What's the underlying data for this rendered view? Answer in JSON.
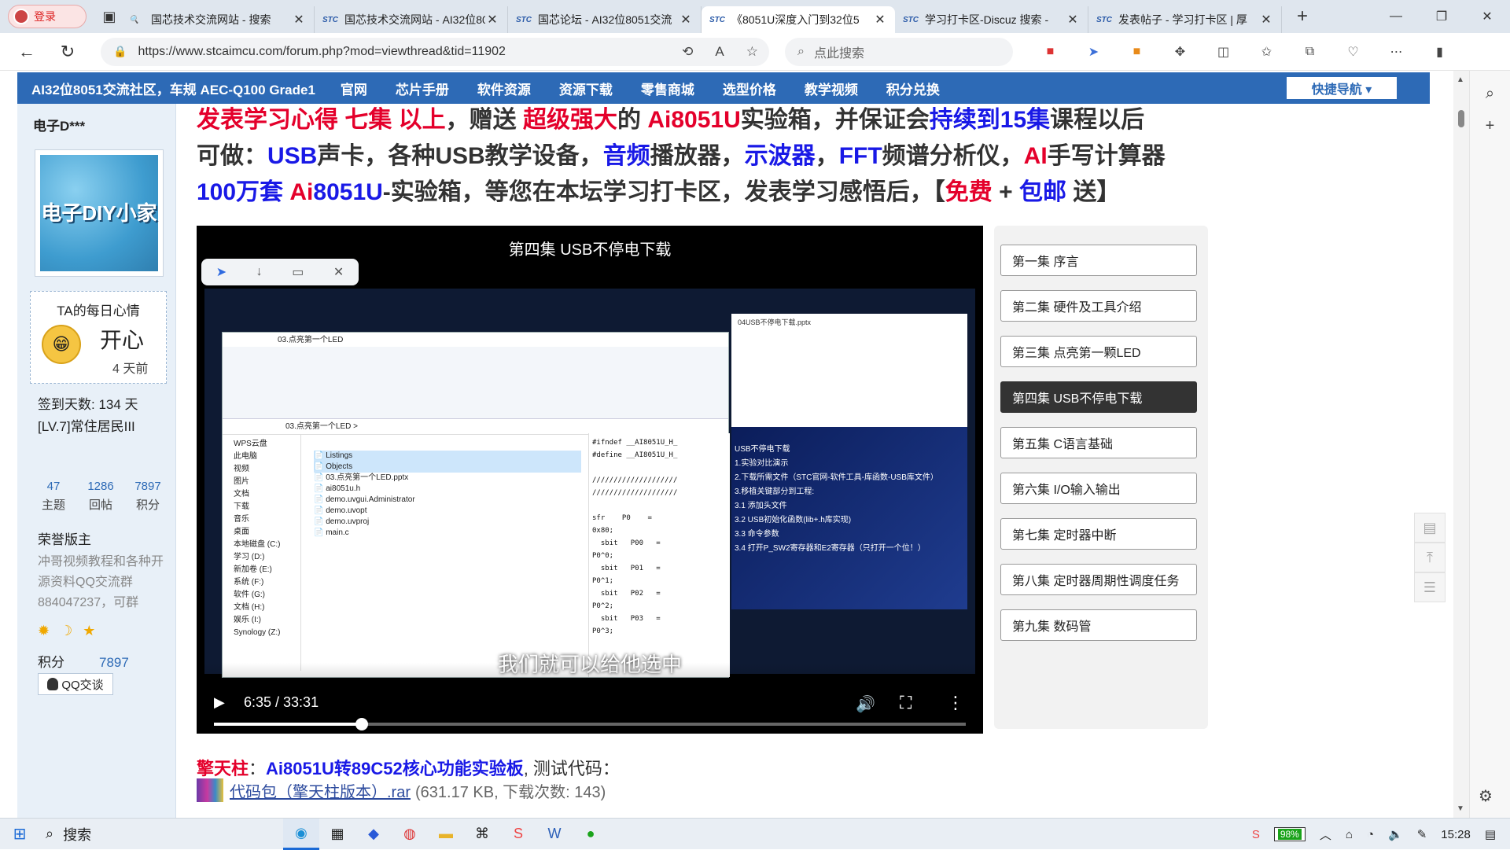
{
  "browser": {
    "profile_label": "登录",
    "tabs": [
      {
        "title": "国芯技术交流网站 - 搜索",
        "active": false,
        "fav": "🔍"
      },
      {
        "title": "国芯技术交流网站 - AI32位8051",
        "active": false,
        "fav": "STC"
      },
      {
        "title": "国芯论坛 - AI32位8051交流",
        "active": false,
        "fav": "STC"
      },
      {
        "title": "《8051U深度入门到32位5",
        "active": true,
        "fav": "STC"
      },
      {
        "title": "学习打卡区-Discuz 搜索 -",
        "active": false,
        "fav": "STC"
      },
      {
        "title": "发表帖子 - 学习打卡区 | 厚",
        "active": false,
        "fav": "STC"
      }
    ],
    "url": "https://www.stcaimcu.com/forum.php?mod=viewthread&tid=11902",
    "search_placeholder": "点此搜索"
  },
  "forum_nav": {
    "title": "AI32位8051交流社区，车规 AEC-Q100 Grade1",
    "items": [
      "官网",
      "芯片手册",
      "软件资源",
      "资源下载",
      "零售商城",
      "选型价格",
      "教学视频",
      "积分兑换"
    ],
    "quick_nav": "快捷导航 ▾"
  },
  "user": {
    "name": "电子D***",
    "avatar_text": "电子DIY小家",
    "mood_title": "TA的每日心情",
    "mood": "开心",
    "mood_time": "4 天前",
    "signin": "签到天数: 134 天",
    "level": "[LV.7]常住居民III",
    "stats": [
      {
        "n": "47",
        "l": "主题"
      },
      {
        "n": "1286",
        "l": "回帖"
      },
      {
        "n": "7897",
        "l": "积分"
      }
    ],
    "honor": "荣誉版主",
    "signature": "冲哥视频教程和各种开源资料QQ交流群884047237，可群",
    "medals": "✹ ☽ ★",
    "score_label": "积分",
    "score_value": "7897",
    "qq_label": "QQ交谈"
  },
  "post": {
    "line1": [
      {
        "t": "发表学习心得 七集 以上",
        "c": "red"
      },
      {
        "t": "，赠送 ",
        "c": ""
      },
      {
        "t": "超级强大",
        "c": "red"
      },
      {
        "t": "的 ",
        "c": ""
      },
      {
        "t": "Ai8051U",
        "c": "red"
      },
      {
        "t": "实验箱，并保证会",
        "c": ""
      },
      {
        "t": "持续到15集",
        "c": "blue"
      },
      {
        "t": "课程以后",
        "c": ""
      }
    ],
    "line2": [
      {
        "t": "可做：",
        "c": ""
      },
      {
        "t": "USB",
        "c": "blue"
      },
      {
        "t": "声卡，各种USB教学设备，",
        "c": ""
      },
      {
        "t": "音频",
        "c": "blue"
      },
      {
        "t": "播放器，",
        "c": ""
      },
      {
        "t": "示波器",
        "c": "blue"
      },
      {
        "t": "，",
        "c": ""
      },
      {
        "t": "FFT",
        "c": "blue"
      },
      {
        "t": "频谱分析仪，",
        "c": ""
      },
      {
        "t": "AI",
        "c": "red"
      },
      {
        "t": "手写计算器",
        "c": ""
      }
    ],
    "line3": [
      {
        "t": "100万套 ",
        "c": "blue"
      },
      {
        "t": "Ai",
        "c": "red"
      },
      {
        "t": "8051U",
        "c": "blue"
      },
      {
        "t": "-实验箱，等您在本坛学习打卡区，发表学习感悟后，【",
        "c": ""
      },
      {
        "t": "免费",
        "c": "red"
      },
      {
        "t": " + ",
        "c": ""
      },
      {
        "t": "包邮",
        "c": "blue"
      },
      {
        "t": " 送】",
        "c": ""
      }
    ]
  },
  "video": {
    "title": "第四集 USB不停电下载",
    "subtitle": "我们就可以给他选中",
    "time": "6:35 / 33:31",
    "progress": 0.197,
    "explorer_title": "03.点亮第一个LED",
    "explorer_path": "03.点亮第一个LED  >",
    "files": [
      "Listings",
      "Objects",
      "03.点亮第一个LED.pptx",
      "ai8051u.h",
      "demo.uvgui.Administrator",
      "demo.uvopt",
      "demo.uvproj",
      "main.c"
    ],
    "nav_items": [
      "WPS云盘",
      "此电脑",
      "视频",
      "图片",
      "文档",
      "下载",
      "音乐",
      "桌面",
      "本地磁盘 (C:)",
      "学习 (D:)",
      "新加卷 (E:)",
      "系统 (F:)",
      "软件 (G:)",
      "文档 (H:)",
      "娱乐 (I:)",
      "Synology (Z:)"
    ],
    "code": "#ifndef __AI8051U_H_\n#define __AI8051U_H_\n\n////////////////////\n////////////////////\n\nsfr    P0    =\n0x80;\n  sbit   P00   =\nP0^0;\n  sbit   P01   =\nP0^1;\n  sbit   P02   =\nP0^2;\n  sbit   P03   =\nP0^3;",
    "ppt_tab": "04USB不停电下载.pptx",
    "slide_lines": [
      "USB不停电下载",
      "1.实验对比演示",
      "2.下载所需文件（STC官网-软件工具-库函数-USB库文件）",
      "3.移植关键部分到工程:",
      "3.1 添加头文件",
      "3.2 USB初始化函数(lib+.h库实现)",
      "3.3 命令参数",
      "3.4 打开P_SW2寄存器和E2寄存器（只打开一个位！）"
    ]
  },
  "episodes": [
    {
      "label": "第一集 序言",
      "active": false
    },
    {
      "label": "第二集 硬件及工具介绍",
      "active": false
    },
    {
      "label": "第三集 点亮第一颗LED",
      "active": false
    },
    {
      "label": "第四集 USB不停电下载",
      "active": true
    },
    {
      "label": "第五集 C语言基础",
      "active": false
    },
    {
      "label": "第六集 I/O输入输出",
      "active": false
    },
    {
      "label": "第七集 定时器中断",
      "active": false
    },
    {
      "label": "第八集 定时器周期性调度任务",
      "active": false
    },
    {
      "label": "第九集 数码管",
      "active": false
    }
  ],
  "below": {
    "name": "擎天柱",
    "sep": "：",
    "board": "Ai8051U转89C52核心功能实验板",
    "text": ", 测试代码：",
    "attach_name": "代码包（擎天柱版本）.rar",
    "attach_meta": "(631.17 KB, 下载次数: 143)"
  },
  "taskbar": {
    "search": "搜索",
    "battery": "98%",
    "time": "15:28"
  }
}
